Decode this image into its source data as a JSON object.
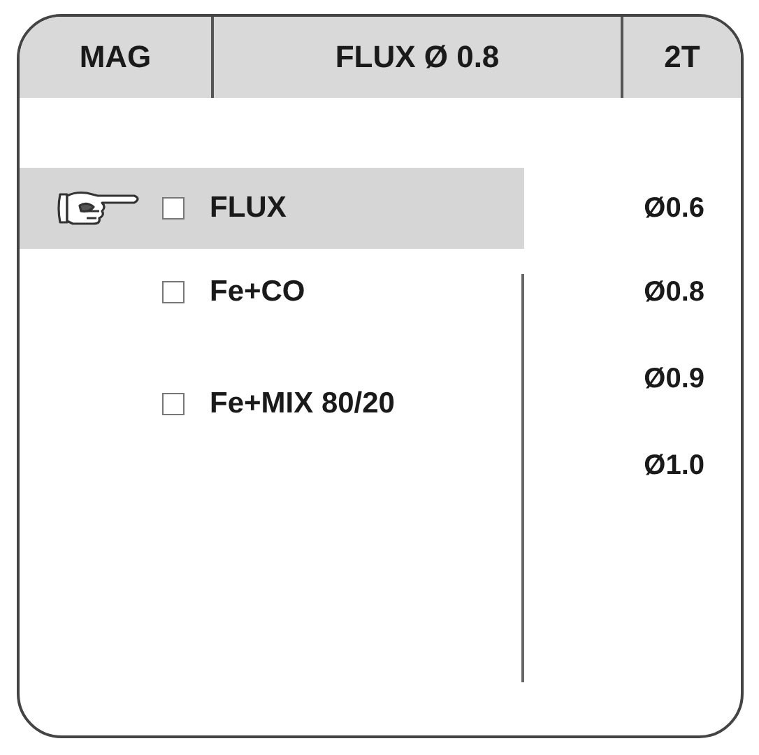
{
  "header": {
    "mode": "MAG",
    "wire": "FLUX Ø 0.8",
    "trigger": "2T"
  },
  "materials": [
    {
      "label": "FLUX",
      "checked": false,
      "selected": true
    },
    {
      "label": "Fe+CO",
      "checked": false,
      "selected": false
    },
    {
      "label": "Fe+MIX 80/20",
      "checked": false,
      "selected": false
    }
  ],
  "diameters": [
    "Ø0.6",
    "Ø0.8",
    "Ø0.9",
    "Ø1.0"
  ]
}
